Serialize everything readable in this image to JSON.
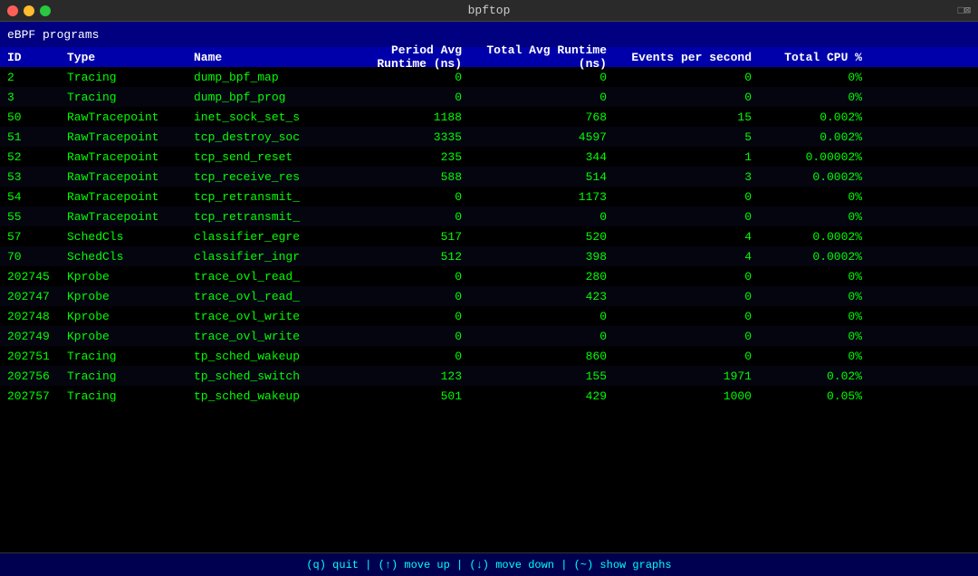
{
  "titlebar": {
    "title": "bpftop",
    "right": "□⊠"
  },
  "section": {
    "title": "eBPF programs"
  },
  "table": {
    "headers": [
      {
        "id": "id",
        "label": "ID"
      },
      {
        "id": "type",
        "label": "Type"
      },
      {
        "id": "name",
        "label": "Name"
      },
      {
        "id": "period",
        "label": "Period Avg Runtime (ns)"
      },
      {
        "id": "total",
        "label": "Total Avg Runtime (ns)"
      },
      {
        "id": "events",
        "label": "Events per second"
      },
      {
        "id": "cpu",
        "label": "Total CPU %"
      }
    ],
    "rows": [
      {
        "id": "2",
        "type": "Tracing",
        "name": "dump_bpf_map",
        "period": "0",
        "total": "0",
        "events": "0",
        "cpu": "0%"
      },
      {
        "id": "3",
        "type": "Tracing",
        "name": "dump_bpf_prog",
        "period": "0",
        "total": "0",
        "events": "0",
        "cpu": "0%"
      },
      {
        "id": "50",
        "type": "RawTracepoint",
        "name": "inet_sock_set_s",
        "period": "1188",
        "total": "768",
        "events": "15",
        "cpu": "0.002%"
      },
      {
        "id": "51",
        "type": "RawTracepoint",
        "name": "tcp_destroy_soc",
        "period": "3335",
        "total": "4597",
        "events": "5",
        "cpu": "0.002%"
      },
      {
        "id": "52",
        "type": "RawTracepoint",
        "name": "tcp_send_reset",
        "period": "235",
        "total": "344",
        "events": "1",
        "cpu": "0.00002%"
      },
      {
        "id": "53",
        "type": "RawTracepoint",
        "name": "tcp_receive_res",
        "period": "588",
        "total": "514",
        "events": "3",
        "cpu": "0.0002%"
      },
      {
        "id": "54",
        "type": "RawTracepoint",
        "name": "tcp_retransmit_",
        "period": "0",
        "total": "1173",
        "events": "0",
        "cpu": "0%"
      },
      {
        "id": "55",
        "type": "RawTracepoint",
        "name": "tcp_retransmit_",
        "period": "0",
        "total": "0",
        "events": "0",
        "cpu": "0%"
      },
      {
        "id": "57",
        "type": "SchedCls",
        "name": "classifier_egre",
        "period": "517",
        "total": "520",
        "events": "4",
        "cpu": "0.0002%"
      },
      {
        "id": "70",
        "type": "SchedCls",
        "name": "classifier_ingr",
        "period": "512",
        "total": "398",
        "events": "4",
        "cpu": "0.0002%"
      },
      {
        "id": "202745",
        "type": "Kprobe",
        "name": "trace_ovl_read_",
        "period": "0",
        "total": "280",
        "events": "0",
        "cpu": "0%"
      },
      {
        "id": "202747",
        "type": "Kprobe",
        "name": "trace_ovl_read_",
        "period": "0",
        "total": "423",
        "events": "0",
        "cpu": "0%"
      },
      {
        "id": "202748",
        "type": "Kprobe",
        "name": "trace_ovl_write",
        "period": "0",
        "total": "0",
        "events": "0",
        "cpu": "0%"
      },
      {
        "id": "202749",
        "type": "Kprobe",
        "name": "trace_ovl_write",
        "period": "0",
        "total": "0",
        "events": "0",
        "cpu": "0%"
      },
      {
        "id": "202751",
        "type": "Tracing",
        "name": "tp_sched_wakeup",
        "period": "0",
        "total": "860",
        "events": "0",
        "cpu": "0%"
      },
      {
        "id": "202756",
        "type": "Tracing",
        "name": "tp_sched_switch",
        "period": "123",
        "total": "155",
        "events": "1971",
        "cpu": "0.02%"
      },
      {
        "id": "202757",
        "type": "Tracing",
        "name": "tp_sched_wakeup",
        "period": "501",
        "total": "429",
        "events": "1000",
        "cpu": "0.05%"
      }
    ]
  },
  "statusbar": {
    "text": "(q) quit | (↑) move up | (↓) move down | (~) show graphs"
  }
}
